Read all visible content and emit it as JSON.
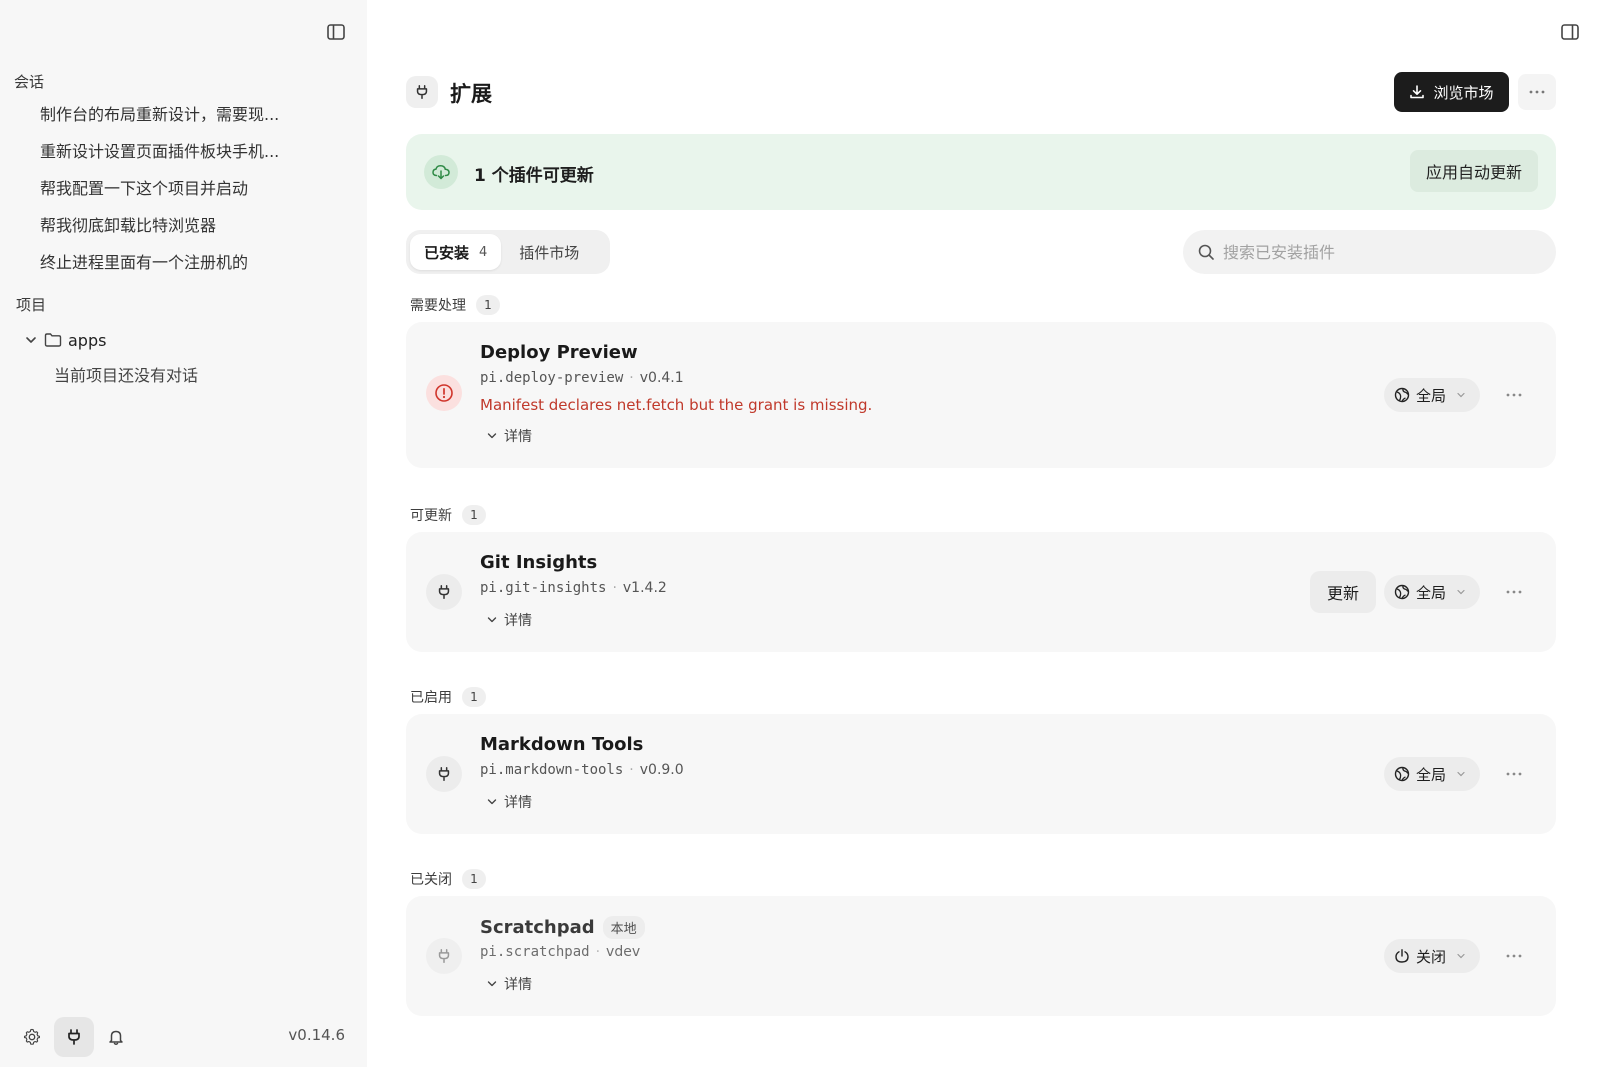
{
  "sidebar": {
    "sessions_label": "会话",
    "sessions": [
      "制作台的布局重新设计，需要现...",
      "重新设计设置页面插件板块手机...",
      "帮我配置一下这个项目并启动",
      "帮我彻底卸载比特浏览器",
      "终止进程里面有一个注册机的"
    ],
    "projects_label": "项目",
    "folder_name": "apps",
    "empty_text": "当前项目还没有对话",
    "version": "v0.14.6"
  },
  "header": {
    "title": "扩展",
    "browse_label": "浏览市场"
  },
  "banner": {
    "text": "1 个插件可更新",
    "auto_update_label": "应用自动更新"
  },
  "tabs": [
    {
      "label": "已安装",
      "count": "4"
    },
    {
      "label": "插件市场"
    }
  ],
  "search": {
    "placeholder": "搜索已安装插件"
  },
  "groups": [
    {
      "label": "需要处理",
      "count": "1",
      "plugin": {
        "name": "Deploy Preview",
        "id": "pi.deploy-preview",
        "version": "v0.4.1",
        "error": "Manifest declares net.fetch but the grant is missing.",
        "details": "详情",
        "scope": "全局"
      }
    },
    {
      "label": "可更新",
      "count": "1",
      "plugin": {
        "name": "Git Insights",
        "id": "pi.git-insights",
        "version": "v1.4.2",
        "details": "详情",
        "update_label": "更新",
        "scope": "全局"
      }
    },
    {
      "label": "已启用",
      "count": "1",
      "plugin": {
        "name": "Markdown Tools",
        "id": "pi.markdown-tools",
        "version": "v0.9.0",
        "details": "详情",
        "scope": "全局"
      }
    },
    {
      "label": "已关闭",
      "count": "1",
      "plugin": {
        "name": "Scratchpad",
        "tag": "本地",
        "id": "pi.scratchpad",
        "version": "vdev",
        "details": "详情",
        "scope": "关闭"
      }
    }
  ],
  "colors": {
    "error": "#c0392b",
    "banner_bg": "#e9f5ec",
    "primary_btn": "#1c1c1c"
  },
  "icons": [
    "sidebar-toggle-icon",
    "plug-icon",
    "download-icon",
    "more-icon",
    "cloud-download-icon",
    "search-icon",
    "alert-circle-icon",
    "globe-icon",
    "power-icon",
    "chevron-down-icon",
    "folder-icon",
    "gear-icon",
    "bell-icon"
  ]
}
